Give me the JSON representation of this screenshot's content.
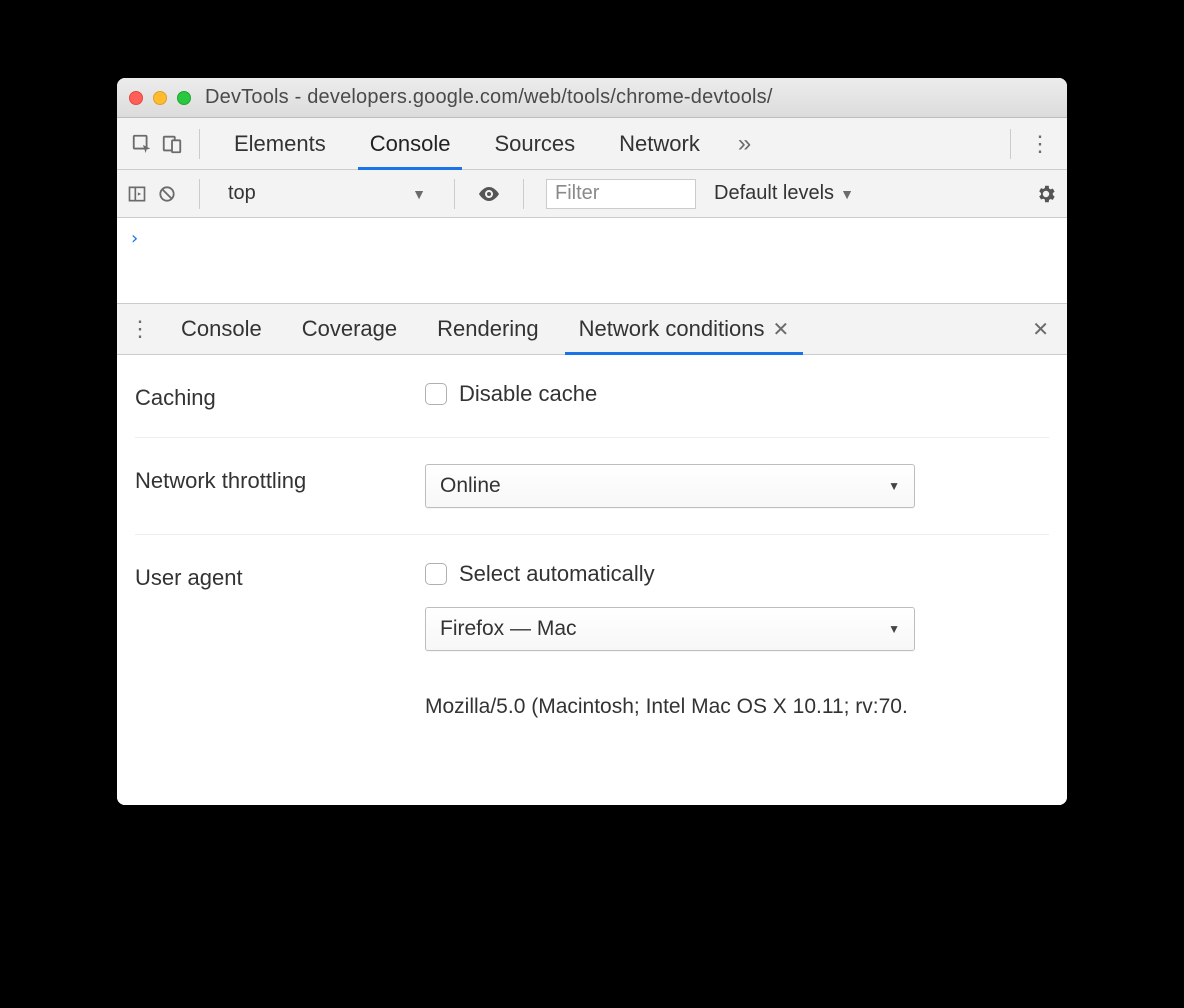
{
  "titlebar": {
    "title": "DevTools - developers.google.com/web/tools/chrome-devtools/"
  },
  "mainTabs": {
    "items": [
      "Elements",
      "Console",
      "Sources",
      "Network"
    ],
    "activeIndex": 1
  },
  "consoleToolbar": {
    "context": "top",
    "filterPlaceholder": "Filter",
    "levelsLabel": "Default levels"
  },
  "drawerTabs": {
    "items": [
      "Console",
      "Coverage",
      "Rendering",
      "Network conditions"
    ],
    "activeIndex": 3
  },
  "networkConditions": {
    "cachingLabel": "Caching",
    "disableCacheLabel": "Disable cache",
    "throttlingLabel": "Network throttling",
    "throttlingValue": "Online",
    "userAgentLabel": "User agent",
    "selectAutoLabel": "Select automatically",
    "uaPreset": "Firefox — Mac",
    "uaString": "Mozilla/5.0 (Macintosh; Intel Mac OS X 10.11; rv:70."
  }
}
